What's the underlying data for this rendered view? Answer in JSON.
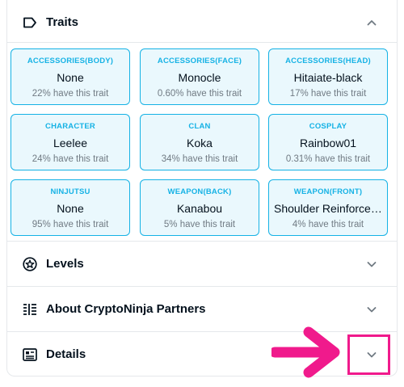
{
  "sections": {
    "traits": {
      "title": "Traits",
      "icon": "tag-icon",
      "state": "expanded"
    },
    "levels": {
      "title": "Levels",
      "icon": "star-circle-icon",
      "state": "collapsed"
    },
    "about": {
      "title": "About CryptoNinja Partners",
      "icon": "list-icon",
      "state": "collapsed"
    },
    "details": {
      "title": "Details",
      "icon": "details-card-icon",
      "state": "collapsed"
    }
  },
  "traits": [
    {
      "type": "ACCESSORIES(BODY)",
      "value": "None",
      "rarity": "22% have this trait"
    },
    {
      "type": "ACCESSORIES(FACE)",
      "value": "Monocle",
      "rarity": "0.60% have this trait"
    },
    {
      "type": "ACCESSORIES(HEAD)",
      "value": "Hitaiate-black",
      "rarity": "17% have this trait"
    },
    {
      "type": "CHARACTER",
      "value": "Leelee",
      "rarity": "24% have this trait"
    },
    {
      "type": "CLAN",
      "value": "Koka",
      "rarity": "34% have this trait"
    },
    {
      "type": "COSPLAY",
      "value": "Rainbow01",
      "rarity": "0.31% have this trait"
    },
    {
      "type": "NINJUTSU",
      "value": "None",
      "rarity": "95% have this trait"
    },
    {
      "type": "WEAPON(BACK)",
      "value": "Kanabou",
      "rarity": "5% have this trait"
    },
    {
      "type": "WEAPON(FRONT)",
      "value": "Shoulder Reinforcement",
      "rarity": "4% have this trait"
    }
  ],
  "colors": {
    "accent": "#15b2e5",
    "trait_bg": "#eaf8fd",
    "annotation": "#f01a8c",
    "text": "#04111d",
    "muted": "#707a83"
  }
}
